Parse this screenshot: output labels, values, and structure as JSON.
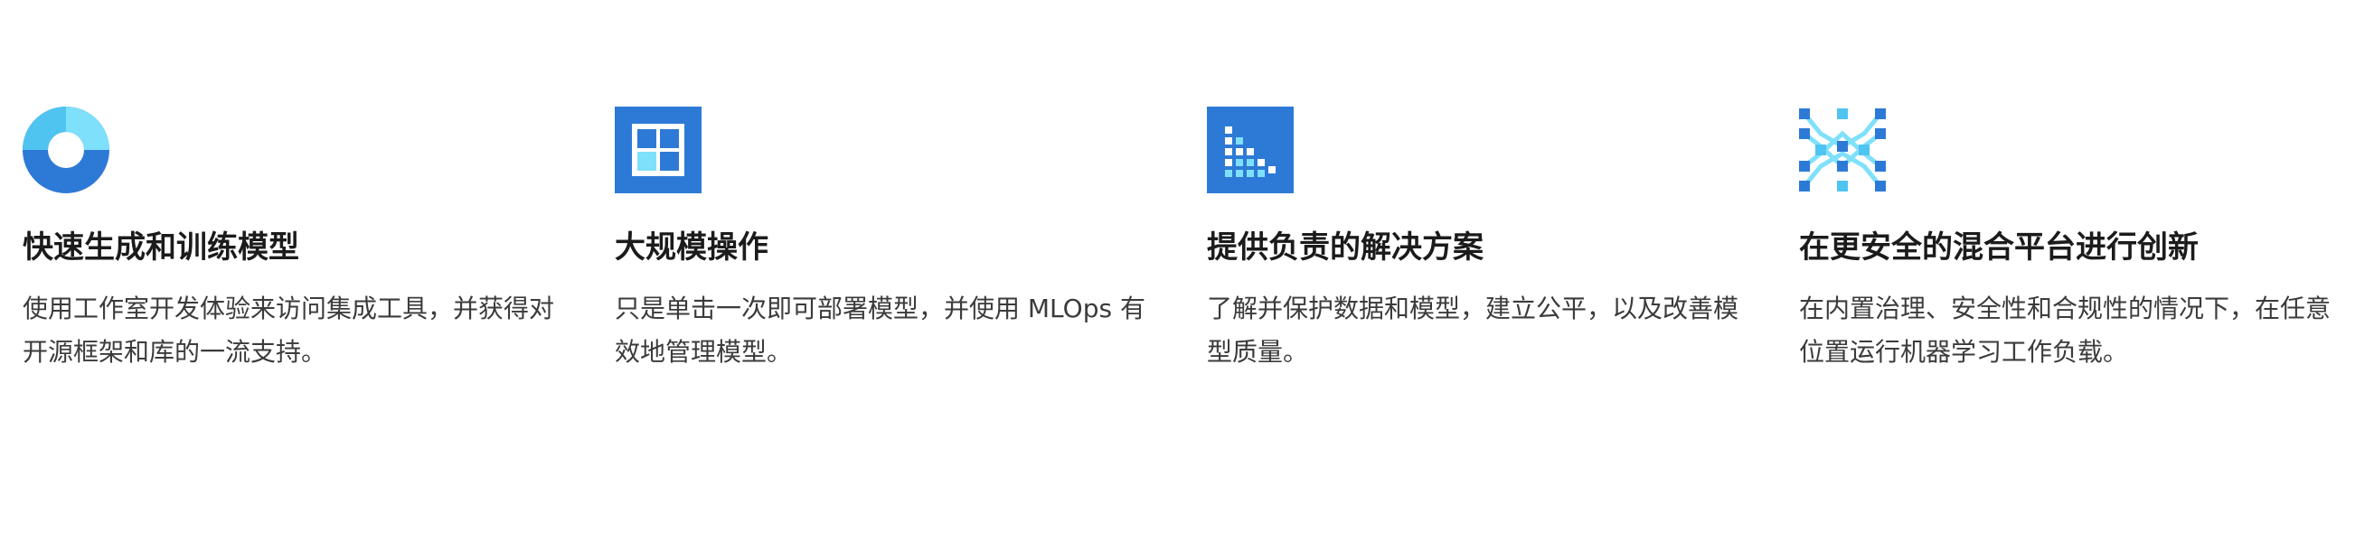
{
  "features": [
    {
      "icon": "donut-chart-icon",
      "title": "快速生成和训练模型",
      "description": "使用工作室开发体验来访问集成工具，并获得对开源框架和库的一流支持。"
    },
    {
      "icon": "grid-window-icon",
      "title": "大规模操作",
      "description": "只是单击一次即可部署模型，并使用 MLOps 有效地管理模型。"
    },
    {
      "icon": "descending-bars-icon",
      "title": "提供负责的解决方案",
      "description": "了解并保护数据和模型，建立公平，以及改善模型质量。"
    },
    {
      "icon": "neural-network-icon",
      "title": "在更安全的混合平台进行创新",
      "description": "在内置治理、安全性和合规性的情况下，在任意位置运行机器学习工作负载。"
    }
  ],
  "colors": {
    "primary_blue": "#2d7ad6",
    "light_blue": "#50c4f0",
    "pale_blue": "#7fe0fb",
    "title_text": "#1b1b1b",
    "body_text": "#3b3b3b"
  }
}
